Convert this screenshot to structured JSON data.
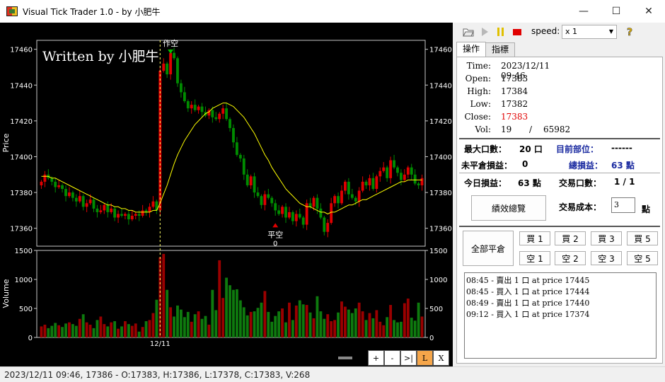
{
  "window": {
    "title": "Visual Tick Trader 1.0 - by 小肥牛",
    "min_glyph": "—",
    "max_glyph": "☐",
    "close_glyph": "✕"
  },
  "chart": {
    "watermark": "Written by 小肥牛",
    "price_label": "Price",
    "volume_label": "Volume",
    "date_label": "12/11",
    "price_ticks": [
      17460,
      17440,
      17420,
      17400,
      17380,
      17360
    ],
    "volume_ticks": [
      1500,
      1000,
      500,
      0
    ],
    "marker_top_label": "作空",
    "marker_bottom_label": "平空",
    "marker_bottom_value": "0",
    "candle_up_color": "#e00000",
    "candle_down_color": "#008c00",
    "ma_color": "#ffff00"
  },
  "chart_data": {
    "type": "candlestick",
    "ylabel": "Price",
    "ylim": [
      17350,
      17465
    ],
    "volume_ylabel": "Volume",
    "volume_ylim": [
      0,
      1500
    ],
    "x_label": "12/11",
    "closes": [
      17386,
      17390,
      17388,
      17386,
      17383,
      17384,
      17382,
      17378,
      17380,
      17377,
      17375,
      17378,
      17372,
      17374,
      17376,
      17371,
      17369,
      17370,
      17373,
      17369,
      17371,
      17366,
      17368,
      17367,
      17368,
      17365,
      17367,
      17368,
      17367,
      17370,
      17369,
      17372,
      17375,
      17370,
      17448,
      17452,
      17446,
      17458,
      17455,
      17441,
      17436,
      17431,
      17427,
      17429,
      17426,
      17428,
      17425,
      17423,
      17426,
      17422,
      17421,
      17424,
      17427,
      17421,
      17416,
      17408,
      17401,
      17399,
      17390,
      17384,
      17389,
      17380,
      17378,
      17373,
      17379,
      17377,
      17374,
      17370,
      17368,
      17372,
      17366,
      17369,
      17364,
      17368,
      17366,
      17362,
      17374,
      17372,
      17377,
      17371,
      17366,
      17358,
      17363,
      17374,
      17378,
      17374,
      17381,
      17386,
      17379,
      17377,
      17375,
      17381,
      17386,
      17384,
      17388,
      17382,
      17389,
      17392,
      17394,
      17388,
      17398,
      17394,
      17391,
      17387,
      17390,
      17394,
      17390,
      17385,
      17384,
      17388
    ],
    "volumes": [
      190,
      220,
      160,
      200,
      250,
      210,
      180,
      240,
      260,
      230,
      200,
      320,
      400,
      260,
      220,
      160,
      300,
      360,
      230,
      190,
      260,
      280,
      150,
      190,
      280,
      230,
      200,
      240,
      100,
      180,
      280,
      300,
      420,
      650,
      1380,
      1440,
      820,
      520,
      360,
      550,
      480,
      350,
      440,
      270,
      400,
      450,
      320,
      370,
      220,
      820,
      470,
      1330,
      680,
      1030,
      900,
      820,
      830,
      640,
      520,
      380,
      440,
      450,
      510,
      600,
      800,
      440,
      270,
      370,
      450,
      500,
      260,
      600,
      300,
      550,
      640,
      570,
      560,
      430,
      330,
      710,
      450,
      320,
      400,
      280,
      300,
      430,
      620,
      530,
      480,
      420,
      500,
      600,
      450,
      300,
      420,
      330,
      470,
      270,
      210,
      350,
      560,
      300,
      260,
      270,
      590,
      670,
      340,
      290,
      600,
      360
    ],
    "ma": [
      17389,
      17389,
      17389,
      17388,
      17388,
      17387,
      17386,
      17385,
      17384,
      17383,
      17382,
      17381,
      17380,
      17379,
      17378,
      17377,
      17376,
      17375,
      17374,
      17373,
      17373,
      17372,
      17372,
      17371,
      17371,
      17370,
      17370,
      17369,
      17369,
      17369,
      17369,
      17369,
      17370,
      17370,
      17374,
      17379,
      17384,
      17390,
      17396,
      17401,
      17405,
      17409,
      17412,
      17415,
      17418,
      17420,
      17422,
      17424,
      17425,
      17427,
      17428,
      17429,
      17430,
      17430,
      17429,
      17428,
      17426,
      17424,
      17422,
      17419,
      17416,
      17413,
      17409,
      17405,
      17401,
      17398,
      17394,
      17391,
      17388,
      17385,
      17382,
      17380,
      17378,
      17376,
      17374,
      17373,
      17372,
      17372,
      17371,
      17370,
      17369,
      17369,
      17368,
      17369,
      17369,
      17370,
      17371,
      17372,
      17373,
      17373,
      17374,
      17375,
      17376,
      17376,
      17377,
      17378,
      17379,
      17380,
      17381,
      17382,
      17383,
      17384,
      17385,
      17386,
      17386,
      17387,
      17387,
      17387,
      17387,
      17387
    ],
    "entry_index": 34,
    "exit_index": 67
  },
  "chart_buttons": [
    "+",
    "-",
    ">|",
    "L",
    "X"
  ],
  "status": {
    "text": "2023/12/11 09:46, 17386 - O:17383, H:17386, L:17378, C:17383, V:268"
  },
  "toolbar": {
    "speed_label": "speed:",
    "speed_value": "x 1",
    "open_icon": "folder-icon",
    "play_icon": "play-icon",
    "pause_icon": "pause-icon",
    "stop_icon": "stop-icon",
    "help_icon": "help-icon"
  },
  "tabs": [
    "操作",
    "指標"
  ],
  "quote": {
    "time_label": "Time:",
    "time": "2023/12/11 09:46",
    "open_label": "Open:",
    "open": "17383",
    "high_label": "High:",
    "high": "17384",
    "low_label": "Low:",
    "low": "17382",
    "close_label": "Close:",
    "close": "17383",
    "vol_label": "Vol:",
    "vol": "19",
    "vol_sep": "/",
    "vol_total": "65982"
  },
  "stats": {
    "max_lots_label": "最大口數：",
    "max_lots": "20 口",
    "position_label": "目前部位：",
    "position": "------",
    "unrealized_label": "未平倉損益：",
    "unrealized": "0",
    "total_pnl_label": "總損益：",
    "total_pnl": "63 點",
    "today_pnl_label": "今日損益：",
    "today_pnl": "63 點",
    "trades_label": "交易口數：",
    "trades": "1 / 1",
    "summary_button": "績效總覽",
    "cost_label": "交易成本：",
    "cost": "3",
    "cost_unit": "點"
  },
  "orders": {
    "close_all": "全部平倉",
    "buy": [
      "買 1",
      "買 2",
      "買 3",
      "買 5"
    ],
    "sell": [
      "空 1",
      "空 2",
      "空 3",
      "空 5"
    ]
  },
  "log": [
    "08:45 - 賣出 1 口 at price 17445",
    "08:45 - 買入 1 口 at price 17444",
    "08:49 - 賣出 1 口 at price 17440",
    "09:12 - 買入 1 口 at price 17374"
  ]
}
